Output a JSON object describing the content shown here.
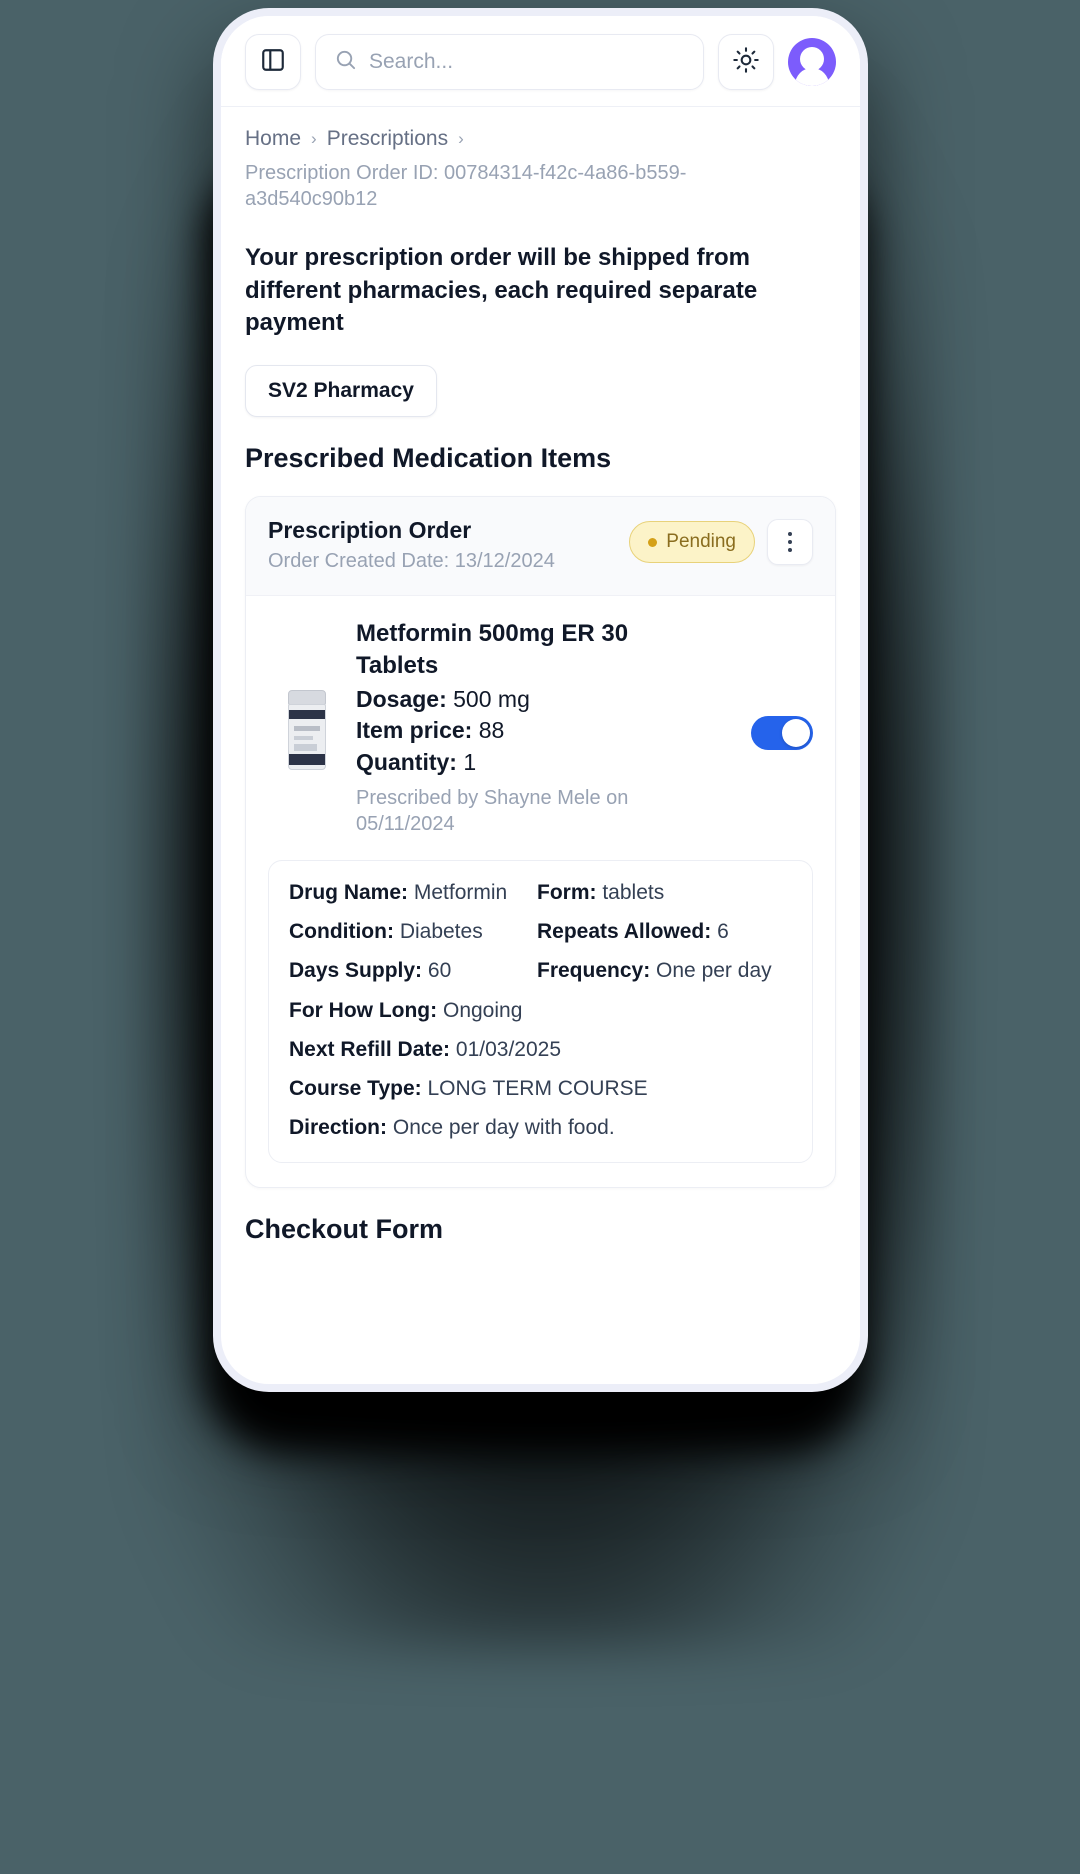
{
  "topbar": {
    "sidebar_toggle_icon": "panel-left-icon",
    "search_placeholder": "Search...",
    "search_value": "",
    "search_icon": "search-icon",
    "theme_toggle_icon": "sun-icon",
    "avatar_icon": "user-avatar"
  },
  "breadcrumb": {
    "items": [
      {
        "label": "Home"
      },
      {
        "label": "Prescriptions"
      }
    ],
    "separator": "›"
  },
  "page": {
    "order_id_text": "Prescription Order ID: 00784314-f42c-4a86-b559-a3d540c90b12",
    "notice": "Your prescription order will be shipped from different pharmacies, each required separate payment",
    "pharmacy_tab": "SV2 Pharmacy",
    "section_title": "Prescribed Medication Items",
    "checkout_title": "Checkout Form"
  },
  "prescription_card": {
    "title": "Prescription Order",
    "created": "Order Created Date: 13/12/2024",
    "status": "Pending",
    "menu_icon": "kebab-menu-icon",
    "toggle_on": true,
    "medication": {
      "name": "Metformin 500mg ER 30 Tablets",
      "dosage_label": "Dosage:",
      "dosage_value": "500 mg",
      "price_label": "Item price:",
      "price_value": "88",
      "quantity_label": "Quantity:",
      "quantity_value": "1",
      "prescribed_by": "Prescribed by Shayne Mele on 05/11/2024",
      "image_icon": "pill-bottle-image"
    },
    "details": [
      {
        "label": "Drug Name:",
        "value": "Metformin"
      },
      {
        "label": "Form:",
        "value": "tablets"
      },
      {
        "label": "Condition:",
        "value": "Diabetes"
      },
      {
        "label": "Repeats Allowed:",
        "value": "6"
      },
      {
        "label": "Days Supply:",
        "value": "60"
      },
      {
        "label": "Frequency:",
        "value": "One per day"
      },
      {
        "label": "For How Long:",
        "value": "Ongoing"
      },
      {
        "label": "Next Refill Date:",
        "value": "01/03/2025"
      },
      {
        "label": "Course Type:",
        "value": "LONG TERM COURSE"
      },
      {
        "label": "Direction:",
        "value": "Once per day with food."
      }
    ]
  },
  "colors": {
    "accent_purple": "#7c5cfc",
    "toggle_blue": "#2563eb",
    "badge_bg": "#fcf3c8",
    "badge_border": "#e8d27a",
    "badge_text": "#8a6d1f",
    "page_bg": "#4a6268"
  }
}
